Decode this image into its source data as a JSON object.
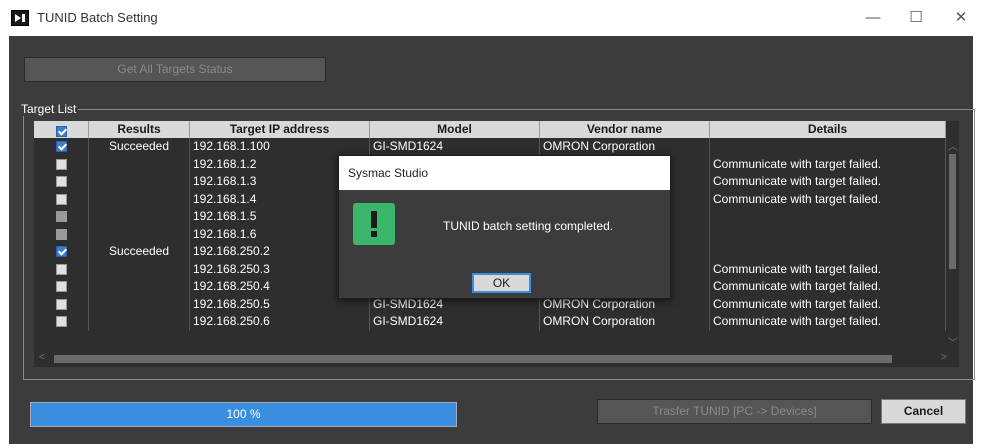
{
  "window": {
    "title": "TUNID Batch Setting",
    "min_icon": "minimize-icon",
    "max_icon": "maximize-icon",
    "close_icon": "close-icon"
  },
  "toolbar": {
    "get_all_label": "Get All Targets Status"
  },
  "target_list": {
    "label": "Target List",
    "columns": [
      "Results",
      "Target IP address",
      "Model",
      "Vendor name",
      "Details"
    ],
    "rows": [
      {
        "checked": true,
        "result": "Succeeded",
        "ip": "192.168.1.100",
        "model": "GI-SMD1624",
        "vendor": "OMRON Corporation",
        "details": ""
      },
      {
        "checked": false,
        "result": "",
        "ip": "192.168.1.2",
        "model": "",
        "vendor": "n",
        "details": "Communicate with target failed."
      },
      {
        "checked": false,
        "result": "",
        "ip": "192.168.1.3",
        "model": "",
        "vendor": "n",
        "details": "Communicate with target failed."
      },
      {
        "checked": false,
        "result": "",
        "ip": "192.168.1.4",
        "model": "",
        "vendor": "n",
        "details": "Communicate with target failed."
      },
      {
        "checked": false,
        "dim": true,
        "result": "",
        "ip": "192.168.1.5",
        "model": "",
        "vendor": "n",
        "details": ""
      },
      {
        "checked": false,
        "dim": true,
        "result": "",
        "ip": "192.168.1.6",
        "model": "",
        "vendor": "n",
        "details": ""
      },
      {
        "checked": true,
        "result": "Succeeded",
        "ip": "192.168.250.2",
        "model": "",
        "vendor": "n",
        "details": ""
      },
      {
        "checked": false,
        "result": "",
        "ip": "192.168.250.3",
        "model": "",
        "vendor": "n",
        "details": "Communicate with target failed."
      },
      {
        "checked": false,
        "result": "",
        "ip": "192.168.250.4",
        "model": "GI-SMD1624",
        "vendor": "OMRON Corporation",
        "details": "Communicate with target failed."
      },
      {
        "checked": false,
        "result": "",
        "ip": "192.168.250.5",
        "model": "GI-SMD1624",
        "vendor": "OMRON Corporation",
        "details": "Communicate with target failed."
      },
      {
        "checked": false,
        "result": "",
        "ip": "192.168.250.6",
        "model": "GI-SMD1624",
        "vendor": "OMRON Corporation",
        "details": "Communicate with target failed."
      }
    ]
  },
  "progress": {
    "label": "100 %",
    "value": 100
  },
  "footer": {
    "transfer_label": "Trasfer TUNID [PC -> Devices]",
    "cancel_label": "Cancel"
  },
  "dialog": {
    "title": "Sysmac Studio",
    "message": "TUNID batch setting completed.",
    "ok_label": "OK",
    "icon": "exclamation-icon"
  },
  "colors": {
    "accent": "#3a8ee0",
    "panel": "#3c3c3c",
    "success_icon": "#3ab76a"
  }
}
